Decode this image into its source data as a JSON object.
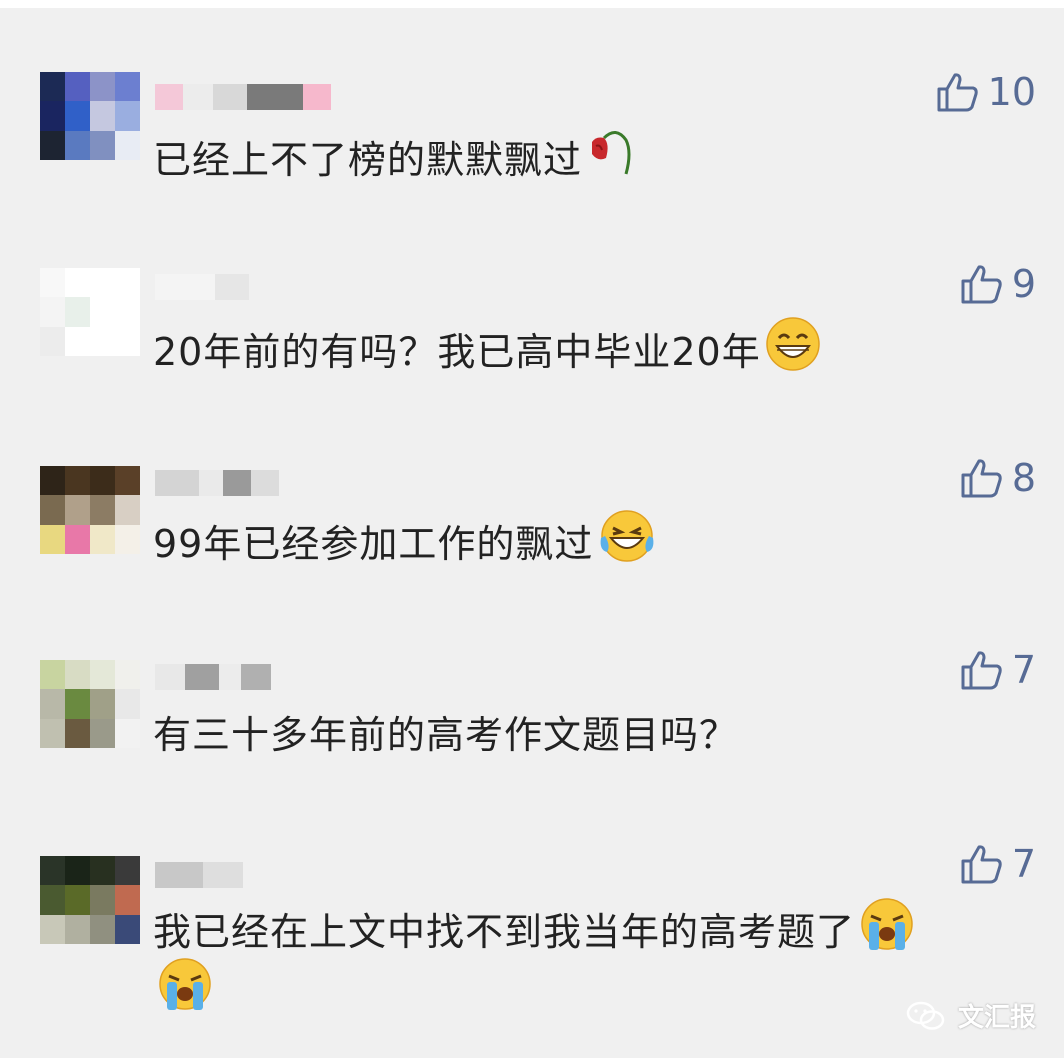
{
  "comments": [
    {
      "text": "已经上不了榜的默默飘过",
      "likes": "10",
      "emoji": "wilted-rose"
    },
    {
      "text": "20年前的有吗？我已高中毕业20年",
      "likes": "9",
      "emoji": "grinning-face"
    },
    {
      "text": "99年已经参加工作的飘过",
      "likes": "8",
      "emoji": "tears-of-joy"
    },
    {
      "text": "有三十多年前的高考作文题目吗？",
      "likes": "7",
      "emoji": ""
    },
    {
      "text": "我已经在上文中找不到我当年的高考题了",
      "likes": "7",
      "emoji": "loudly-crying"
    }
  ],
  "watermark": {
    "label": "文汇报",
    "icon": "wechat-icon"
  },
  "colors": {
    "like": "#576b95",
    "text": "#222222",
    "background": "#f0f0f0"
  }
}
